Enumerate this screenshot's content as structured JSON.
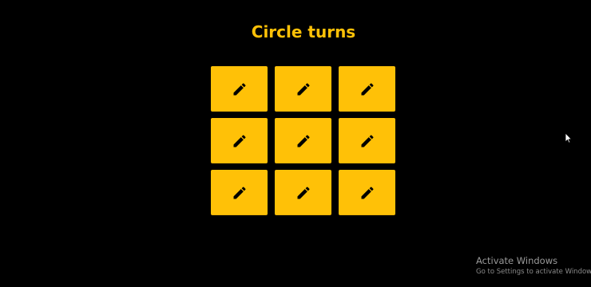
{
  "header": {
    "title": "Circle turns"
  },
  "board": {
    "cells": [
      {
        "icon": "pencil-icon"
      },
      {
        "icon": "pencil-icon"
      },
      {
        "icon": "pencil-icon"
      },
      {
        "icon": "pencil-icon"
      },
      {
        "icon": "pencil-icon"
      },
      {
        "icon": "pencil-icon"
      },
      {
        "icon": "pencil-icon"
      },
      {
        "icon": "pencil-icon"
      },
      {
        "icon": "pencil-icon"
      }
    ]
  },
  "colors": {
    "background": "#000000",
    "accent": "#ffc107",
    "icon": "#000000"
  },
  "watermark": {
    "title": "Activate Windows",
    "subtitle": "Go to Settings to activate Windows."
  }
}
